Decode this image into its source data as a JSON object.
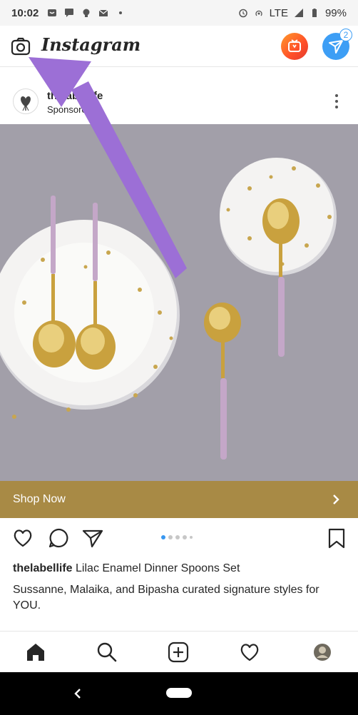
{
  "status_bar": {
    "time": "10:02",
    "network": "LTE",
    "battery": "99%"
  },
  "header": {
    "brand": "Instagram",
    "dm_badge_count": "2",
    "igtv_color": "#ff5a2b",
    "dm_color": "#3d9ef5"
  },
  "post": {
    "account": "thelabellife",
    "sponsored_label": "Sponsored",
    "cta_label": "Shop Now",
    "cta_color": "#a88a45",
    "caption_user": "thelabellife",
    "caption_text": "Lilac Enamel Dinner Spoons Set",
    "description": "Sussanne, Malaika, and Bipasha curated signature styles for YOU.",
    "carousel_total_dots": 5,
    "carousel_active_index": 0
  },
  "annotation": {
    "arrow_color": "#9c6fd6",
    "points_to": "camera-icon"
  }
}
